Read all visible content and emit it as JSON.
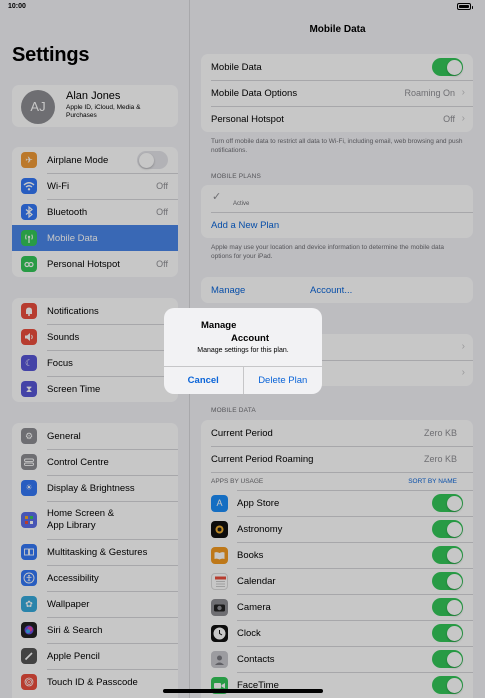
{
  "status_bar": {
    "time": "10:00"
  },
  "sidebar": {
    "title": "Settings",
    "profile": {
      "initials": "AJ",
      "name": "Alan Jones",
      "subtitle": "Apple ID, iCloud, Media & Purchases"
    },
    "group1": [
      {
        "label": "Airplane Mode",
        "icon": "airplane-icon",
        "color": "#f09a37",
        "toggle": false
      },
      {
        "label": "Wi-Fi",
        "icon": "wifi-icon",
        "color": "#3478f6",
        "value": "Off"
      },
      {
        "label": "Bluetooth",
        "icon": "bluetooth-icon",
        "color": "#3478f6",
        "value": "Off"
      },
      {
        "label": "Mobile Data",
        "icon": "antenna-icon",
        "color": "#34c759",
        "selected": true
      },
      {
        "label": "Personal Hotspot",
        "icon": "hotspot-icon",
        "color": "#34c759",
        "value": "Off"
      }
    ],
    "group2": [
      {
        "label": "Notifications",
        "icon": "bell-icon",
        "color": "#eb4d3d"
      },
      {
        "label": "Sounds",
        "icon": "speaker-icon",
        "color": "#eb4d3d"
      },
      {
        "label": "Focus",
        "icon": "moon-icon",
        "color": "#5856d6"
      },
      {
        "label": "Screen Time",
        "icon": "hourglass-icon",
        "color": "#5856d6"
      }
    ],
    "group3": [
      {
        "label": "General",
        "icon": "gear-icon",
        "color": "#8e8e93"
      },
      {
        "label": "Control Centre",
        "icon": "sliders-icon",
        "color": "#8e8e93"
      },
      {
        "label": "Display & Brightness",
        "icon": "aa-icon",
        "color": "#3478f6"
      },
      {
        "label": "Home Screen & App Library",
        "line1": "Home Screen &",
        "line2": "App Library",
        "icon": "grid-icon",
        "color": "#3478f6"
      },
      {
        "label": "Multitasking & Gestures",
        "icon": "multitask-icon",
        "color": "#3478f6"
      },
      {
        "label": "Accessibility",
        "icon": "accessibility-icon",
        "color": "#3478f6"
      },
      {
        "label": "Wallpaper",
        "icon": "flower-icon",
        "color": "#36aadc"
      },
      {
        "label": "Siri & Search",
        "icon": "siri-icon",
        "color": "#222"
      },
      {
        "label": "Apple Pencil",
        "icon": "pencil-icon",
        "color": "#555"
      },
      {
        "label": "Touch ID & Passcode",
        "icon": "fingerprint-icon",
        "color": "#eb4d3d"
      }
    ]
  },
  "detail": {
    "title": "Mobile Data",
    "mobile_data": {
      "label": "Mobile Data",
      "on": true
    },
    "options": {
      "label": "Mobile Data Options",
      "value": "Roaming On"
    },
    "hotspot": {
      "label": "Personal Hotspot",
      "value": "Off"
    },
    "note1": "Turn off mobile data to restrict all data to Wi-Fi, including email, web browsing and push notifications.",
    "plans_header": "MOBILE PLANS",
    "plan_status": "Active",
    "add_plan": "Add a New Plan",
    "note2": "Apple may use your location and device information to determine the mobile data options for your iPad.",
    "manage": "Manage",
    "account": "Account...",
    "usage_header": "MOBILE DATA",
    "current_period": {
      "label": "Current Period",
      "value": "Zero KB"
    },
    "roaming_period": {
      "label": "Current Period Roaming",
      "value": "Zero KB"
    },
    "apps_header": "APPS BY USAGE",
    "sort_label": "SORT BY NAME",
    "apps": [
      {
        "label": "App Store",
        "icon": "appstore-icon",
        "color": "#1c8ef9",
        "on": true
      },
      {
        "label": "Astronomy",
        "icon": "astronomy-icon",
        "color": "#111",
        "on": true
      },
      {
        "label": "Books",
        "icon": "book-icon",
        "color": "#f49a20",
        "on": true
      },
      {
        "label": "Calendar",
        "icon": "calendar-icon",
        "color": "#ffffff",
        "on": true
      },
      {
        "label": "Camera",
        "icon": "camera-icon",
        "color": "#8e8e93",
        "on": true
      },
      {
        "label": "Clock",
        "icon": "clock-icon",
        "color": "#111",
        "on": true
      },
      {
        "label": "Contacts",
        "icon": "contacts-icon",
        "color": "#b8b8bd",
        "on": true
      },
      {
        "label": "FaceTime",
        "icon": "facetime-icon",
        "color": "#34c759",
        "on": true
      }
    ]
  },
  "dialog": {
    "title_line1": "Manage",
    "title_line2": "Account",
    "message": "Manage settings for this plan.",
    "cancel": "Cancel",
    "delete": "Delete Plan"
  }
}
